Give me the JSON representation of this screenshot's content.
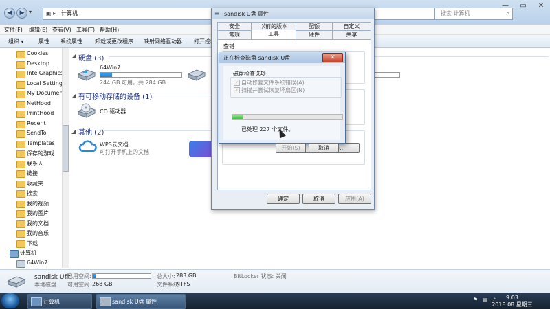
{
  "explorer": {
    "address_segment": "计算机",
    "search_placeholder": "搜索 计算机",
    "menu": [
      "文件(F)",
      "编辑(E)",
      "查看(V)",
      "工具(T)",
      "帮助(H)"
    ],
    "toolbar": [
      "组织 ▾",
      "属性",
      "系统属性",
      "卸载或更改程序",
      "映射网络驱动器",
      "打开控制"
    ],
    "sidebar": [
      "Cookies",
      "Desktop",
      "IntelGraphicsI",
      "Local Settings",
      "My Document",
      "NetHood",
      "PrintHood",
      "Recent",
      "SendTo",
      "Templates",
      "保存的游戏",
      "联系人",
      "链接",
      "收藏夹",
      "搜索",
      "我的视频",
      "我的图片",
      "我的文档",
      "我的音乐",
      "下载",
      "计算机",
      "64Win7"
    ],
    "groups": {
      "hdd": "硬盘 (3)",
      "removable": "有可移动存储的设备 (1)",
      "other": "其他 (2)"
    },
    "drive_64": {
      "name": "64Win7",
      "free_text": "244 GB 可用，共 284 GB",
      "used_fraction": 0.14
    },
    "cd_drive": {
      "name": "CD 驱动器"
    },
    "wps": {
      "name": "WPS云文档",
      "desc": "可打开手机上的文档"
    },
    "details": {
      "name": "sandisk U盘",
      "type": "本地磁盘",
      "used_label": "已用空间:",
      "free_label": "可用空间:",
      "free_value": "268 GB",
      "total_label": "总大小:",
      "total_value": "283 GB",
      "fs_label": "文件系统:",
      "fs_value": "NTFS",
      "bitlocker": "BitLocker 状态: 关闭",
      "used_fraction": 0.06
    }
  },
  "taskbar": {
    "items": [
      "计算机",
      "sandisk U盘 属性"
    ],
    "time": "9:03",
    "date": "2018.08.星期三"
  },
  "props": {
    "title": "sandisk U盘 属性",
    "tabs_row1": [
      "安全",
      "以前的版本",
      "配额",
      "自定义"
    ],
    "tabs_row2": [
      "常规",
      "工具",
      "硬件",
      "共享"
    ],
    "section_check": "查错",
    "defrag_button": "开始备份(B)...",
    "ok": "确定",
    "cancel": "取消",
    "apply": "应用(A)"
  },
  "checkdisk": {
    "title": "正在检查磁盘 sandisk U盘",
    "close": "✕",
    "options_label": "磁盘检查选项",
    "option1": "自动修复文件系统错误(A)",
    "option2": "扫描并尝试恢复坏扇区(N)",
    "progress_fraction": 0.1,
    "status": "已处理 227 个文件。",
    "start": "开始(S)",
    "cancel": "取消"
  }
}
